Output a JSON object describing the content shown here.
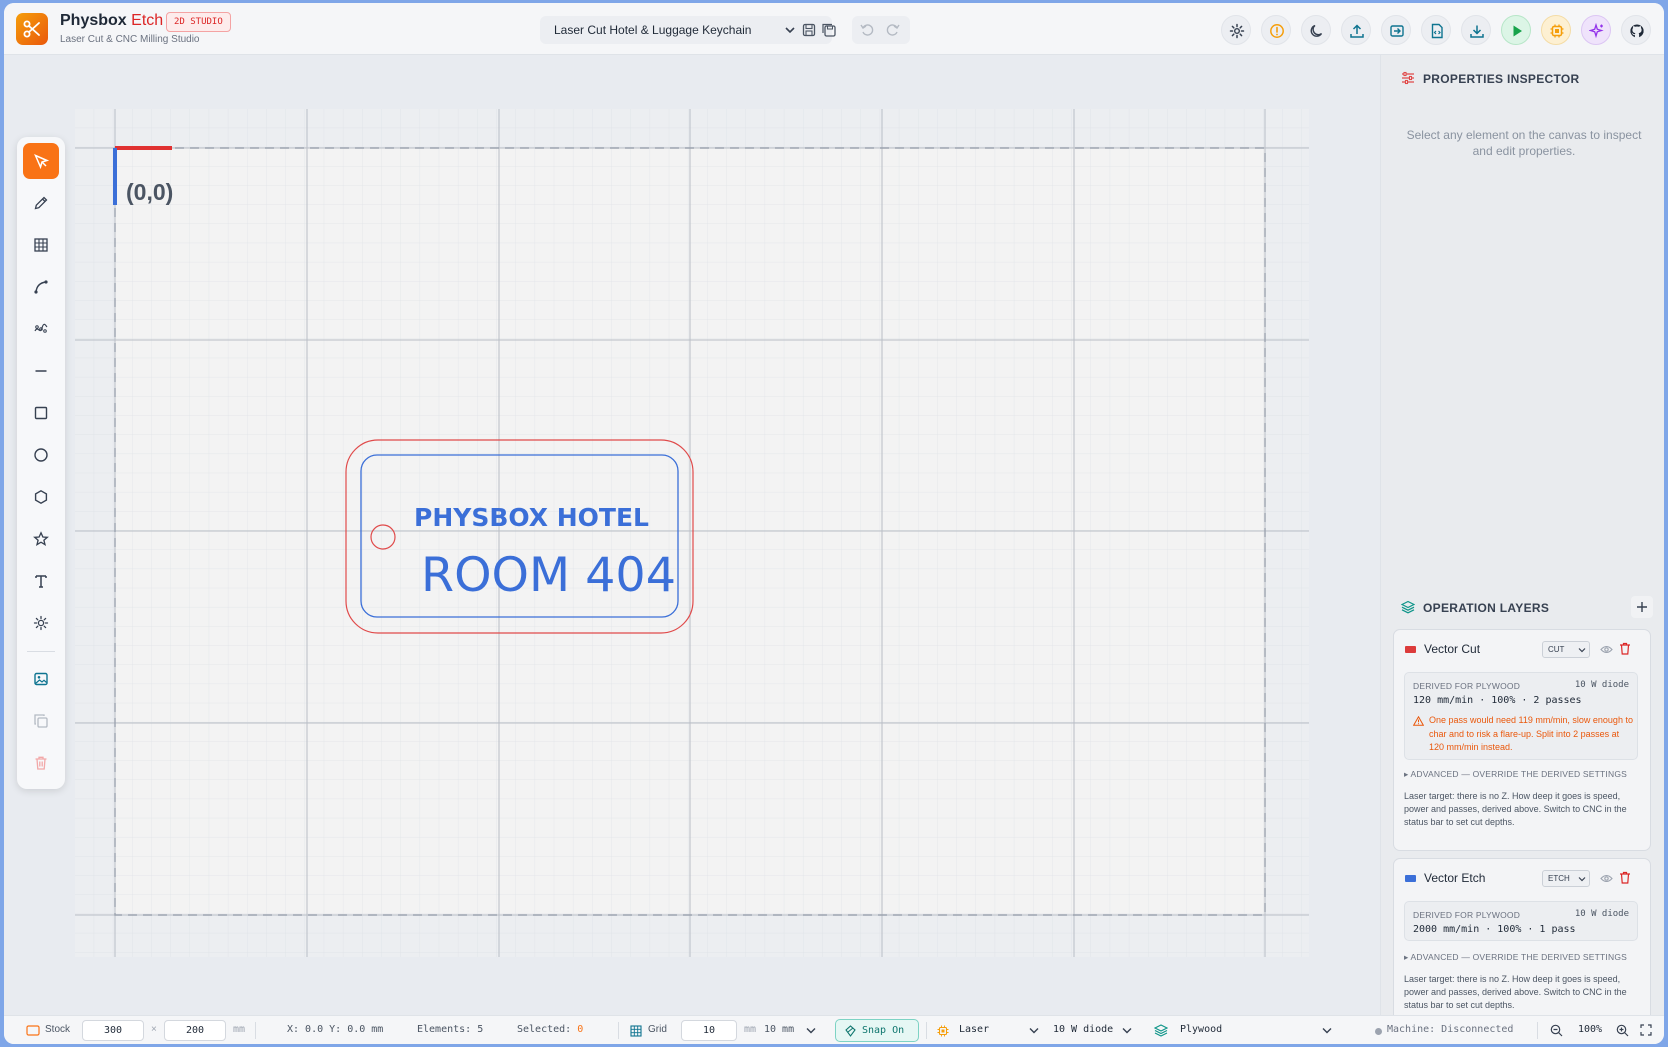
{
  "app": {
    "name": "Physbox",
    "name_accent": "Etch",
    "badge": "2D STUDIO",
    "subtitle": "Laser Cut & CNC Milling Studio"
  },
  "project": {
    "name": "Laser Cut Hotel & Luggage Keychain"
  },
  "canvas": {
    "origin_label": "(0,0)",
    "keychain": {
      "line1": "PHYSBOX HOTEL",
      "line2": "ROOM 404"
    }
  },
  "properties": {
    "title": "PROPERTIES INSPECTOR",
    "empty_message": "Select any element on the canvas to inspect and edit properties."
  },
  "layers": {
    "title": "OPERATION LAYERS",
    "items": [
      {
        "name": "Vector Cut",
        "mode": "CUT",
        "color": "#dc3b3b",
        "derived_header": "DERIVED FOR PLYWOOD",
        "machine": "10 W diode",
        "values": "120 mm/min · 100% · 2 passes",
        "warning": "One pass would need 119 mm/min, slow enough to char and to risk a flare-up. Split into 2 passes at 120 mm/min instead.",
        "advanced": "▸ ADVANCED — OVERRIDE THE DERIVED SETTINGS",
        "note": "Laser target: there is no Z. How deep it goes is speed, power and passes, derived above. Switch to CNC in the status bar to set cut depths."
      },
      {
        "name": "Vector Etch",
        "mode": "ETCH",
        "color": "#3b6fd8",
        "derived_header": "DERIVED FOR PLYWOOD",
        "machine": "10 W diode",
        "values": "2000 mm/min · 100% · 1 pass",
        "advanced": "▸ ADVANCED — OVERRIDE THE DERIVED SETTINGS",
        "note": "Laser target: there is no Z. How deep it goes is speed, power and passes, derived above. Switch to CNC in the status bar to set cut depths."
      }
    ]
  },
  "status": {
    "stock_label": "Stock",
    "stock_w": "300",
    "times": "×",
    "stock_h": "200",
    "stock_unit": "mm",
    "coords": "X: 0.0 Y: 0.0 mm",
    "elements": "Elements: 5",
    "selected_label": "Selected:",
    "selected_value": "0",
    "grid_label": "Grid",
    "grid_value": "10",
    "grid_unit": "mm",
    "grid_select": "10 mm",
    "snap": "Snap On",
    "mode": "Laser",
    "machine": "10 W diode",
    "material": "Plywood",
    "connection": "Machine: Disconnected",
    "zoom": "100%"
  },
  "colors": {
    "accent": "#f97316",
    "cut": "#dc3b3b",
    "etch": "#3b6fd8"
  }
}
